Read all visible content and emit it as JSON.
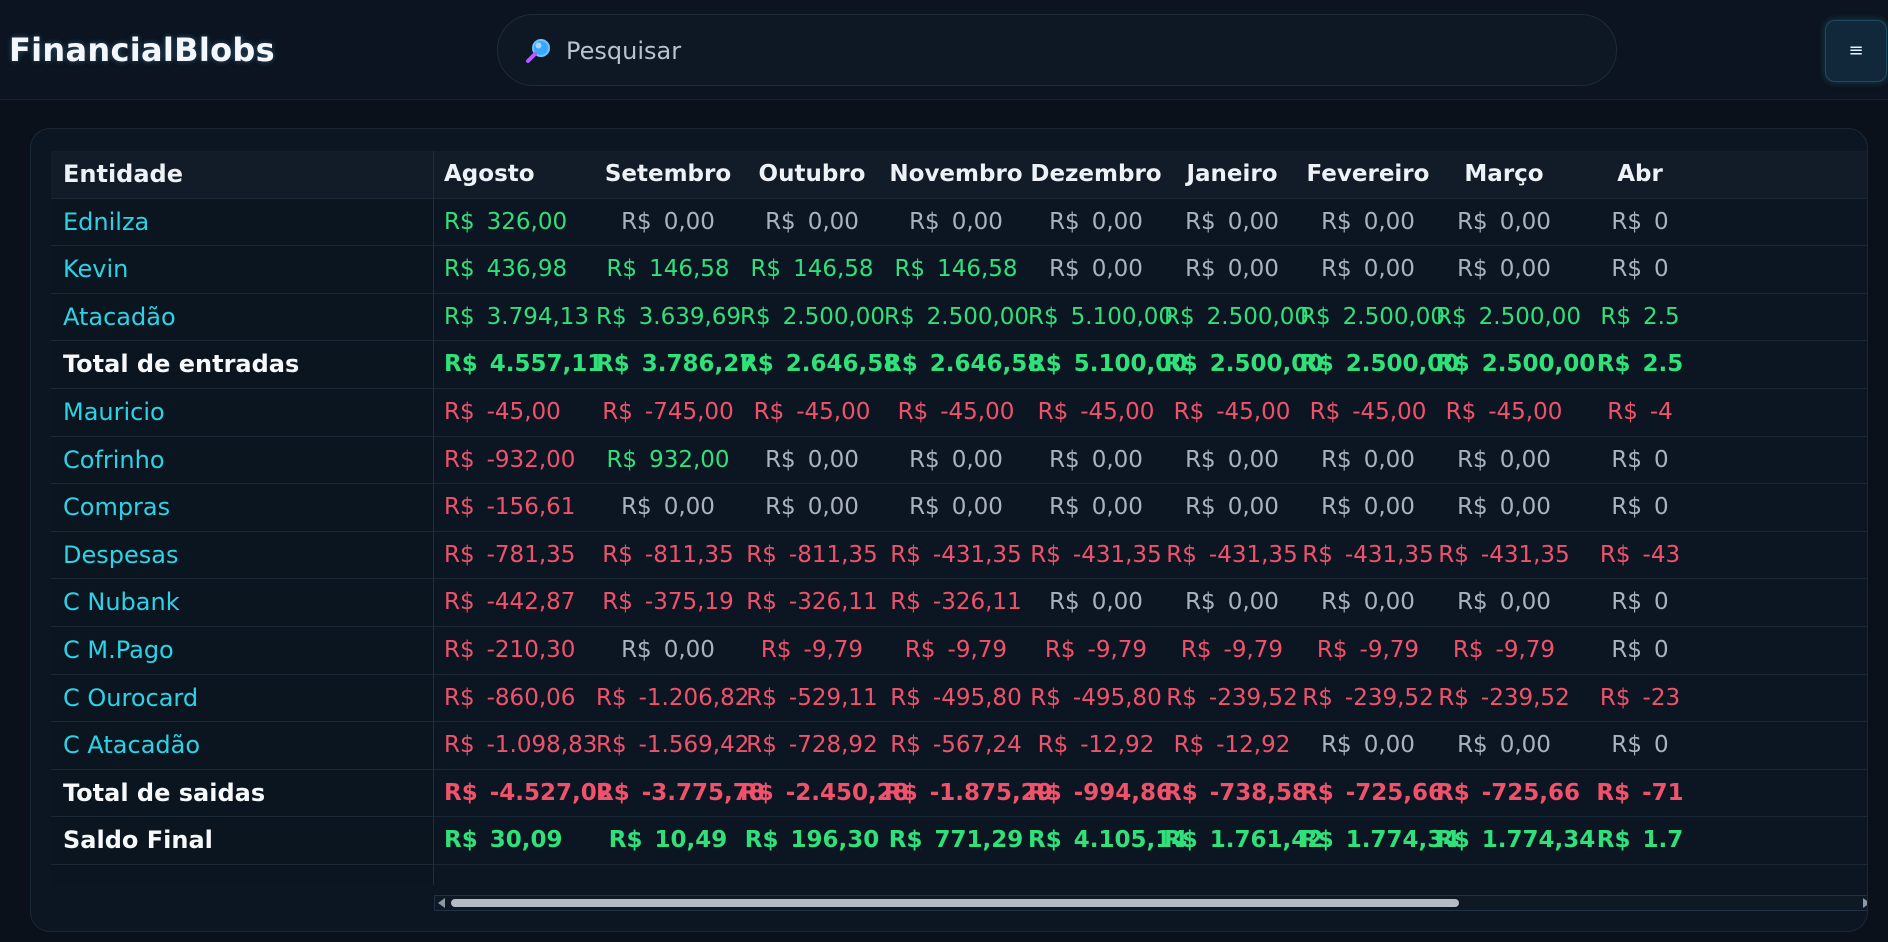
{
  "app": {
    "title": "FinancialBlobs"
  },
  "search": {
    "placeholder": "Pesquisar",
    "value": ""
  },
  "menu": {
    "label": "≡"
  },
  "table": {
    "currency": "R$",
    "entity_header": "Entidade",
    "months": [
      "Agosto",
      "Setembro",
      "Outubro",
      "Novembro",
      "Dezembro",
      "Janeiro",
      "Fevereiro",
      "Março",
      "Abr"
    ],
    "rows": [
      {
        "label": "Ednilza",
        "type": "entity",
        "values": [
          "326,00",
          "0,00",
          "0,00",
          "0,00",
          "0,00",
          "0,00",
          "0,00",
          "0,00",
          "0"
        ]
      },
      {
        "label": "Kevin",
        "type": "entity",
        "values": [
          "436,98",
          "146,58",
          "146,58",
          "146,58",
          "0,00",
          "0,00",
          "0,00",
          "0,00",
          "0"
        ]
      },
      {
        "label": "Atacadão",
        "type": "entity",
        "values": [
          "3.794,13",
          "3.639,69",
          "2.500,00",
          "2.500,00",
          "5.100,00",
          "2.500,00",
          "2.500,00",
          "2.500,00",
          "2.5"
        ]
      },
      {
        "label": "Total de entradas",
        "type": "total",
        "values": [
          "4.557,11",
          "3.786,27",
          "2.646,58",
          "2.646,58",
          "5.100,00",
          "2.500,00",
          "2.500,00",
          "2.500,00",
          "2.5"
        ]
      },
      {
        "label": "Mauricio",
        "type": "entity",
        "values": [
          "-45,00",
          "-745,00",
          "-45,00",
          "-45,00",
          "-45,00",
          "-45,00",
          "-45,00",
          "-45,00",
          "-4"
        ]
      },
      {
        "label": "Cofrinho",
        "type": "entity",
        "values": [
          "-932,00",
          "932,00",
          "0,00",
          "0,00",
          "0,00",
          "0,00",
          "0,00",
          "0,00",
          "0"
        ]
      },
      {
        "label": "Compras",
        "type": "entity",
        "values": [
          "-156,61",
          "0,00",
          "0,00",
          "0,00",
          "0,00",
          "0,00",
          "0,00",
          "0,00",
          "0"
        ]
      },
      {
        "label": "Despesas",
        "type": "entity",
        "values": [
          "-781,35",
          "-811,35",
          "-811,35",
          "-431,35",
          "-431,35",
          "-431,35",
          "-431,35",
          "-431,35",
          "-43"
        ]
      },
      {
        "label": "C Nubank",
        "type": "entity",
        "values": [
          "-442,87",
          "-375,19",
          "-326,11",
          "-326,11",
          "0,00",
          "0,00",
          "0,00",
          "0,00",
          "0"
        ]
      },
      {
        "label": "C M.Pago",
        "type": "entity",
        "values": [
          "-210,30",
          "0,00",
          "-9,79",
          "-9,79",
          "-9,79",
          "-9,79",
          "-9,79",
          "-9,79",
          "0"
        ]
      },
      {
        "label": "C Ourocard",
        "type": "entity",
        "values": [
          "-860,06",
          "-1.206,82",
          "-529,11",
          "-495,80",
          "-495,80",
          "-239,52",
          "-239,52",
          "-239,52",
          "-23"
        ]
      },
      {
        "label": "C Atacadão",
        "type": "entity",
        "values": [
          "-1.098,83",
          "-1.569,42",
          "-728,92",
          "-567,24",
          "-12,92",
          "-12,92",
          "0,00",
          "0,00",
          "0"
        ]
      },
      {
        "label": "Total de saidas",
        "type": "total",
        "values": [
          "-4.527,02",
          "-3.775,78",
          "-2.450,28",
          "-1.875,29",
          "-994,86",
          "-738,58",
          "-725,66",
          "-725,66",
          "-71"
        ]
      },
      {
        "label": "Saldo Final",
        "type": "total",
        "values": [
          "30,09",
          "10,49",
          "196,30",
          "771,29",
          "4.105,14",
          "1.761,42",
          "1.774,34",
          "1.774,34",
          "1.7"
        ]
      }
    ]
  },
  "colors": {
    "positive": "#2fe07b",
    "negative": "#f0526c",
    "zero": "#aab3bd",
    "entity": "#2cd3e6"
  }
}
